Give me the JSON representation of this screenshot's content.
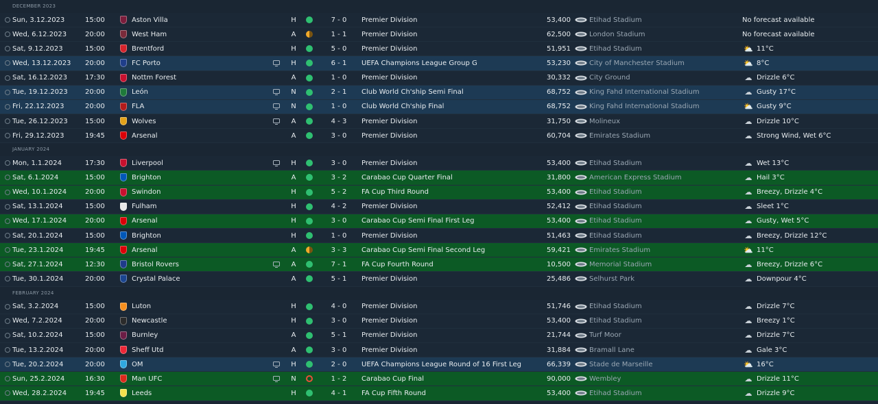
{
  "colors": {
    "win": "#2fbf71",
    "draw": "#f0a92a",
    "loss": "#e8503a",
    "row_default": "#1b2836",
    "row_european": "#1d3a54",
    "row_domestic_cup": "#0c5a25"
  },
  "icons": {
    "tv": "tv-icon",
    "stadium": "stadium-icon",
    "weather_sun": "sun-icon",
    "weather_cloud": "cloud-icon"
  },
  "fixtures": [
    {
      "type": "month",
      "label": "DECEMBER 2023"
    },
    {
      "type": "match",
      "date": "Sun, 3.12.2023",
      "time": "15:00",
      "opponent": "Aston Villa",
      "crest": "#7a1d3b",
      "tv": false,
      "venue": "H",
      "result": "win",
      "score": "7 - 0",
      "competition": "Premier Division",
      "attendance": "53,400",
      "stadium": "Etihad Stadium",
      "weather": "No forecast available",
      "weather_icon": "",
      "row": "default"
    },
    {
      "type": "match",
      "date": "Wed, 6.12.2023",
      "time": "20:00",
      "opponent": "West Ham",
      "crest": "#7a2a3a",
      "tv": false,
      "venue": "A",
      "result": "draw",
      "score": "1 - 1",
      "competition": "Premier Division",
      "attendance": "62,500",
      "stadium": "London Stadium",
      "weather": "No forecast available",
      "weather_icon": "",
      "row": "default"
    },
    {
      "type": "match",
      "date": "Sat, 9.12.2023",
      "time": "15:00",
      "opponent": "Brentford",
      "crest": "#d6232b",
      "tv": false,
      "venue": "H",
      "result": "win",
      "score": "5 - 0",
      "competition": "Premier Division",
      "attendance": "51,951",
      "stadium": "Etihad Stadium",
      "weather": "11°C",
      "weather_icon": "sun-icon",
      "row": "default"
    },
    {
      "type": "match",
      "date": "Wed, 13.12.2023",
      "time": "20:00",
      "opponent": "FC Porto",
      "crest": "#1f3e8a",
      "tv": true,
      "venue": "H",
      "result": "win",
      "score": "6 - 1",
      "competition": "UEFA Champions League Group G",
      "attendance": "53,230",
      "stadium": "City of Manchester Stadium",
      "weather": "8°C",
      "weather_icon": "sun-icon",
      "row": "european"
    },
    {
      "type": "match",
      "date": "Sat, 16.12.2023",
      "time": "17:30",
      "opponent": "Nottm Forest",
      "crest": "#c8102e",
      "tv": false,
      "venue": "A",
      "result": "win",
      "score": "1 - 0",
      "competition": "Premier Division",
      "attendance": "30,332",
      "stadium": "City Ground",
      "weather": "Drizzle 6°C",
      "weather_icon": "cloud-icon",
      "row": "default"
    },
    {
      "type": "match",
      "date": "Tue, 19.12.2023",
      "time": "20:00",
      "opponent": "León",
      "crest": "#1e7a3a",
      "tv": true,
      "venue": "N",
      "result": "win",
      "score": "2 - 1",
      "competition": "Club World Ch'ship Semi Final",
      "attendance": "68,752",
      "stadium": "King Fahd International Stadium",
      "weather": "Gusty 17°C",
      "weather_icon": "cloud-icon",
      "row": "european"
    },
    {
      "type": "match",
      "date": "Fri, 22.12.2023",
      "time": "20:00",
      "opponent": "FLA",
      "crest": "#b31b1b",
      "tv": true,
      "venue": "N",
      "result": "win",
      "score": "1 - 0",
      "competition": "Club World Ch'ship Final",
      "attendance": "68,752",
      "stadium": "King Fahd International Stadium",
      "weather": "Gusty 9°C",
      "weather_icon": "sun-icon",
      "row": "european"
    },
    {
      "type": "match",
      "date": "Tue, 26.12.2023",
      "time": "15:00",
      "opponent": "Wolves",
      "crest": "#e3a21a",
      "tv": true,
      "venue": "A",
      "result": "win",
      "score": "4 - 3",
      "competition": "Premier Division",
      "attendance": "31,750",
      "stadium": "Molineux",
      "weather": "Drizzle 10°C",
      "weather_icon": "cloud-icon",
      "row": "default"
    },
    {
      "type": "match",
      "date": "Fri, 29.12.2023",
      "time": "19:45",
      "opponent": "Arsenal",
      "crest": "#db0007",
      "tv": false,
      "venue": "A",
      "result": "win",
      "score": "3 - 0",
      "competition": "Premier Division",
      "attendance": "60,704",
      "stadium": "Emirates Stadium",
      "weather": "Strong Wind, Wet 6°C",
      "weather_icon": "cloud-icon",
      "row": "default"
    },
    {
      "type": "month",
      "label": "JANUARY 2024"
    },
    {
      "type": "match",
      "date": "Mon, 1.1.2024",
      "time": "17:30",
      "opponent": "Liverpool",
      "crest": "#c8102e",
      "tv": true,
      "venue": "H",
      "result": "win",
      "score": "3 - 0",
      "competition": "Premier Division",
      "attendance": "53,400",
      "stadium": "Etihad Stadium",
      "weather": "Wet 13°C",
      "weather_icon": "cloud-icon",
      "row": "default"
    },
    {
      "type": "match",
      "date": "Sat, 6.1.2024",
      "time": "15:00",
      "opponent": "Brighton",
      "crest": "#0057b8",
      "tv": false,
      "venue": "A",
      "result": "win",
      "score": "3 - 2",
      "competition": "Carabao Cup Quarter Final",
      "attendance": "31,800",
      "stadium": "American Express Stadium",
      "weather": "Hail 3°C",
      "weather_icon": "cloud-icon",
      "row": "domestic_cup"
    },
    {
      "type": "match",
      "date": "Wed, 10.1.2024",
      "time": "20:00",
      "opponent": "Swindon",
      "crest": "#c8102e",
      "tv": false,
      "venue": "H",
      "result": "win",
      "score": "5 - 2",
      "competition": "FA Cup Third Round",
      "attendance": "53,400",
      "stadium": "Etihad Stadium",
      "weather": "Breezy, Drizzle 4°C",
      "weather_icon": "cloud-icon",
      "row": "domestic_cup"
    },
    {
      "type": "match",
      "date": "Sat, 13.1.2024",
      "time": "15:00",
      "opponent": "Fulham",
      "crest": "#e8e8e8",
      "tv": false,
      "venue": "H",
      "result": "win",
      "score": "4 - 2",
      "competition": "Premier Division",
      "attendance": "52,412",
      "stadium": "Etihad Stadium",
      "weather": "Sleet 1°C",
      "weather_icon": "cloud-icon",
      "row": "default"
    },
    {
      "type": "match",
      "date": "Wed, 17.1.2024",
      "time": "20:00",
      "opponent": "Arsenal",
      "crest": "#db0007",
      "tv": false,
      "venue": "H",
      "result": "win",
      "score": "3 - 0",
      "competition": "Carabao Cup Semi Final First Leg",
      "attendance": "53,400",
      "stadium": "Etihad Stadium",
      "weather": "Gusty, Wet 5°C",
      "weather_icon": "cloud-icon",
      "row": "domestic_cup"
    },
    {
      "type": "match",
      "date": "Sat, 20.1.2024",
      "time": "15:00",
      "opponent": "Brighton",
      "crest": "#0057b8",
      "tv": false,
      "venue": "H",
      "result": "win",
      "score": "1 - 0",
      "competition": "Premier Division",
      "attendance": "51,463",
      "stadium": "Etihad Stadium",
      "weather": "Breezy, Drizzle 12°C",
      "weather_icon": "cloud-icon",
      "row": "default"
    },
    {
      "type": "match",
      "date": "Tue, 23.1.2024",
      "time": "19:45",
      "opponent": "Arsenal",
      "crest": "#db0007",
      "tv": false,
      "venue": "A",
      "result": "draw",
      "score": "3 - 3",
      "competition": "Carabao Cup Semi Final Second Leg",
      "attendance": "59,421",
      "stadium": "Emirates Stadium",
      "weather": "11°C",
      "weather_icon": "sun-icon",
      "row": "domestic_cup"
    },
    {
      "type": "match",
      "date": "Sat, 27.1.2024",
      "time": "12:30",
      "opponent": "Bristol Rovers",
      "crest": "#1e3b8a",
      "tv": true,
      "venue": "A",
      "result": "win",
      "score": "7 - 1",
      "competition": "FA Cup Fourth Round",
      "attendance": "10,500",
      "stadium": "Memorial Stadium",
      "weather": "Breezy, Drizzle 6°C",
      "weather_icon": "cloud-icon",
      "row": "domestic_cup"
    },
    {
      "type": "match",
      "date": "Tue, 30.1.2024",
      "time": "20:00",
      "opponent": "Crystal Palace",
      "crest": "#1b458f",
      "tv": false,
      "venue": "A",
      "result": "win",
      "score": "5 - 1",
      "competition": "Premier Division",
      "attendance": "25,486",
      "stadium": "Selhurst Park",
      "weather": "Downpour 4°C",
      "weather_icon": "cloud-icon",
      "row": "default"
    },
    {
      "type": "month",
      "label": "FEBRUARY 2024"
    },
    {
      "type": "match",
      "date": "Sat, 3.2.2024",
      "time": "15:00",
      "opponent": "Luton",
      "crest": "#f78f1e",
      "tv": false,
      "venue": "H",
      "result": "win",
      "score": "4 - 0",
      "competition": "Premier Division",
      "attendance": "51,746",
      "stadium": "Etihad Stadium",
      "weather": "Drizzle 7°C",
      "weather_icon": "cloud-icon",
      "row": "default"
    },
    {
      "type": "match",
      "date": "Wed, 7.2.2024",
      "time": "20:00",
      "opponent": "Newcastle",
      "crest": "#2b2b2b",
      "tv": false,
      "venue": "H",
      "result": "win",
      "score": "3 - 0",
      "competition": "Premier Division",
      "attendance": "53,400",
      "stadium": "Etihad Stadium",
      "weather": "Breezy 1°C",
      "weather_icon": "cloud-icon",
      "row": "default"
    },
    {
      "type": "match",
      "date": "Sat, 10.2.2024",
      "time": "15:00",
      "opponent": "Burnley",
      "crest": "#6c1d45",
      "tv": false,
      "venue": "A",
      "result": "win",
      "score": "5 - 1",
      "competition": "Premier Division",
      "attendance": "21,744",
      "stadium": "Turf Moor",
      "weather": "Drizzle 7°C",
      "weather_icon": "cloud-icon",
      "row": "default"
    },
    {
      "type": "match",
      "date": "Tue, 13.2.2024",
      "time": "20:00",
      "opponent": "Sheff Utd",
      "crest": "#ee2737",
      "tv": false,
      "venue": "A",
      "result": "win",
      "score": "3 - 0",
      "competition": "Premier Division",
      "attendance": "31,884",
      "stadium": "Bramall Lane",
      "weather": "Gale 3°C",
      "weather_icon": "cloud-icon",
      "row": "default"
    },
    {
      "type": "match",
      "date": "Tue, 20.2.2024",
      "time": "20:00",
      "opponent": "OM",
      "crest": "#2fa8df",
      "tv": true,
      "venue": "H",
      "result": "win",
      "score": "2 - 0",
      "competition": "UEFA Champions League Round of 16 First Leg",
      "attendance": "66,339",
      "stadium": "Stade de Marseille",
      "weather": "16°C",
      "weather_icon": "sun-icon",
      "row": "european"
    },
    {
      "type": "match",
      "date": "Sun, 25.2.2024",
      "time": "16:30",
      "opponent": "Man UFC",
      "crest": "#da291c",
      "tv": true,
      "venue": "N",
      "result": "loss",
      "score": "1 - 2",
      "competition": "Carabao Cup Final",
      "attendance": "90,000",
      "stadium": "Wembley",
      "weather": "Drizzle 11°C",
      "weather_icon": "cloud-icon",
      "row": "domestic_cup"
    },
    {
      "type": "match",
      "date": "Wed, 28.2.2024",
      "time": "19:45",
      "opponent": "Leeds",
      "crest": "#f4e04d",
      "tv": false,
      "venue": "H",
      "result": "win",
      "score": "4 - 1",
      "competition": "FA Cup Fifth Round",
      "attendance": "53,400",
      "stadium": "Etihad Stadium",
      "weather": "Drizzle 9°C",
      "weather_icon": "cloud-icon",
      "row": "domestic_cup"
    }
  ]
}
